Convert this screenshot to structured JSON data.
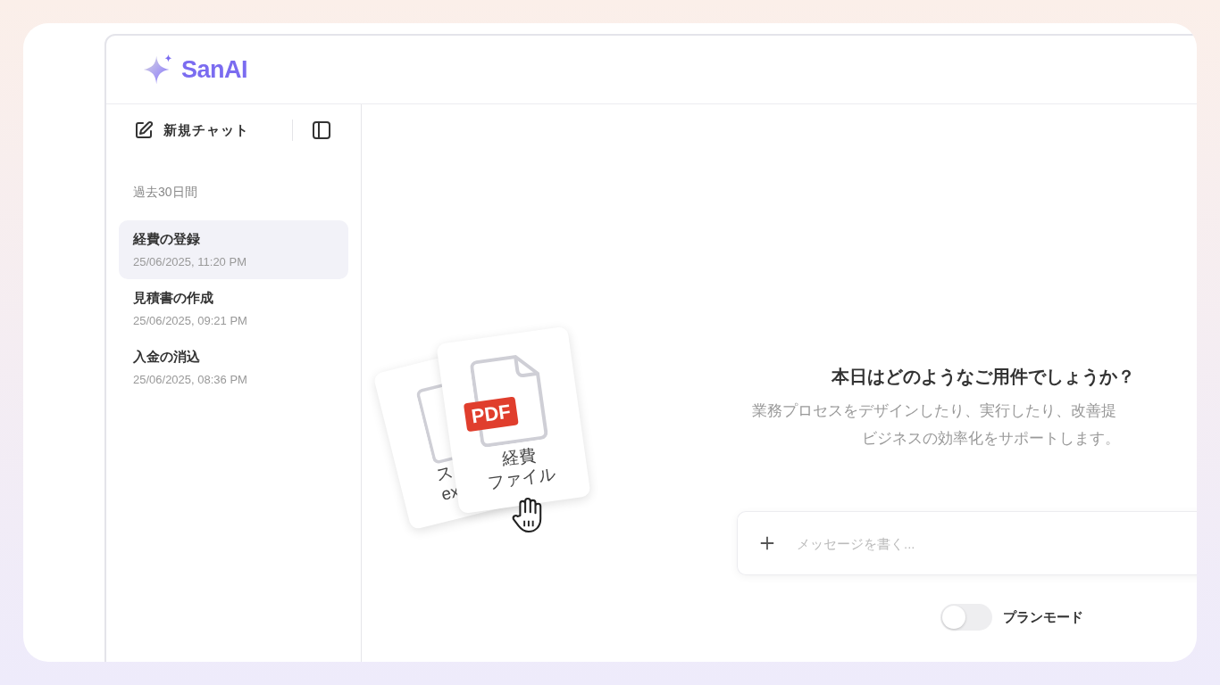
{
  "app": {
    "name": "SanAI"
  },
  "sidebar": {
    "new_chat": "新規チャット",
    "section": "過去30日間",
    "items": [
      {
        "title": "経費の登録",
        "time": "25/06/2025, 11:20 PM",
        "selected": true
      },
      {
        "title": "見積書の作成",
        "time": "25/06/2025, 09:21 PM",
        "selected": false
      },
      {
        "title": "入金の消込",
        "time": "25/06/2025, 08:36 PM",
        "selected": false
      }
    ]
  },
  "illustration": {
    "back_card": {
      "lines": [
        "ス",
        "ex"
      ]
    },
    "front_card": {
      "badge": "PDF",
      "lines": [
        "経費",
        "ファイル"
      ]
    }
  },
  "main": {
    "title": "本日はどのようなご用件でしょうか？",
    "subtitle_lines": [
      "業務プロセスをデザインしたり、実行したり、改善提",
      "ビジネスの効率化をサポートします。"
    ],
    "input": {
      "placeholder": "メッセージを書く..."
    },
    "plan_mode": {
      "label": "プランモード",
      "on": false
    }
  }
}
